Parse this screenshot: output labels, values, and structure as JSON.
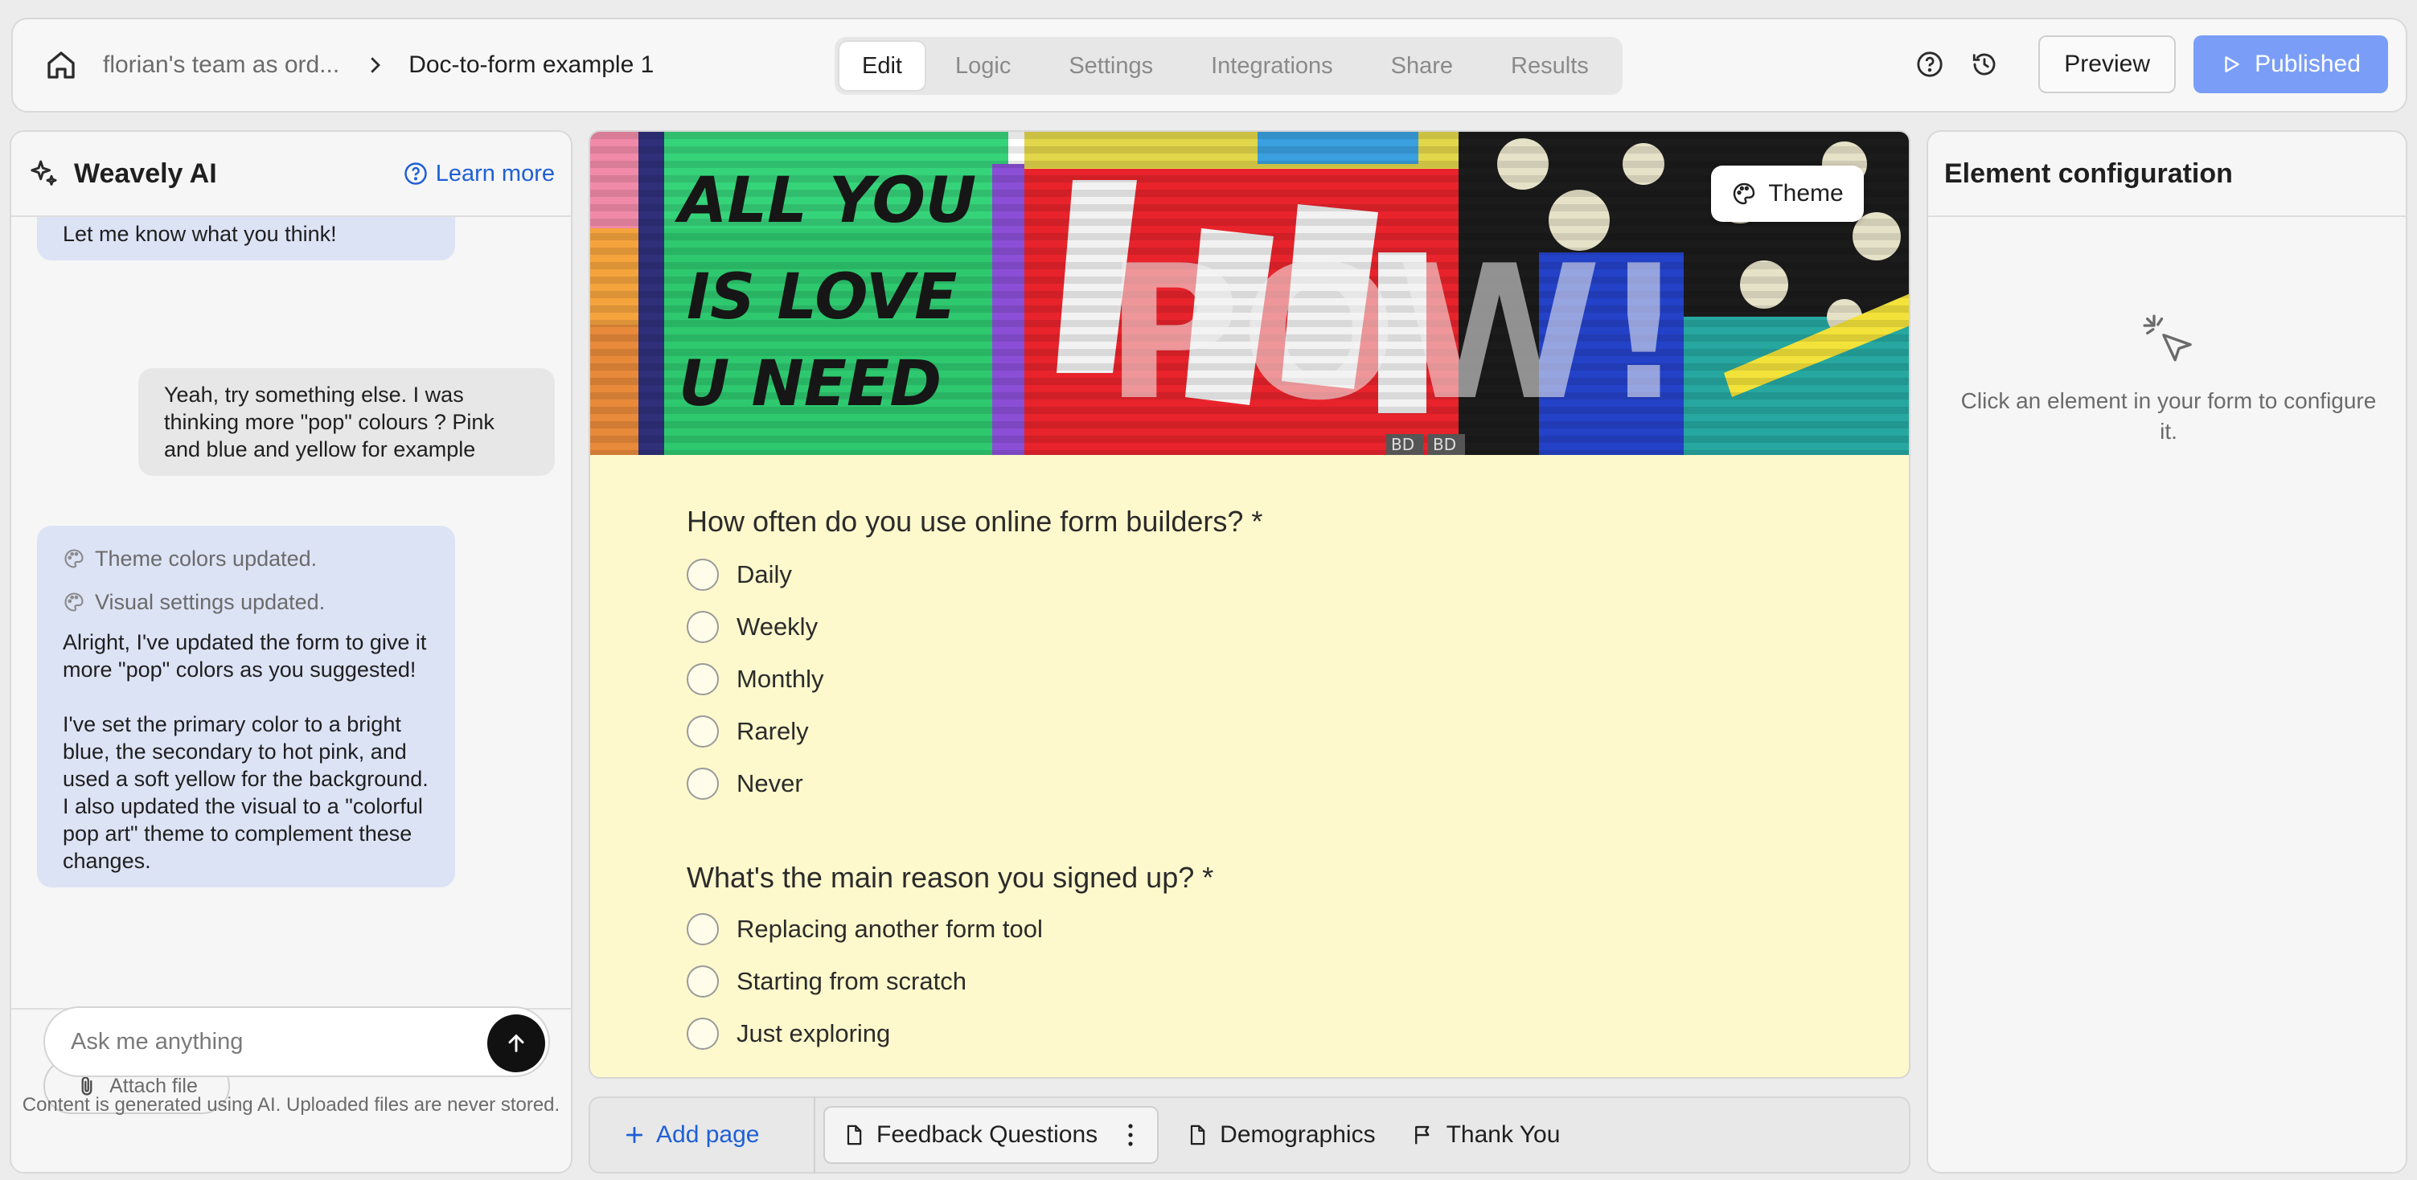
{
  "colors": {
    "accent": "#1f5fd6",
    "published_bg": "#7a9ef7",
    "form_background": "#fef9cc",
    "ai_bubble": "#dce3f5",
    "user_bubble": "#e7e7e7"
  },
  "header": {
    "breadcrumb": {
      "team": "florian's team as ord...",
      "form": "Doc-to-form example 1"
    },
    "tabs": [
      {
        "label": "Edit",
        "active": true
      },
      {
        "label": "Logic",
        "active": false
      },
      {
        "label": "Settings",
        "active": false
      },
      {
        "label": "Integrations",
        "active": false
      },
      {
        "label": "Share",
        "active": false
      },
      {
        "label": "Results",
        "active": false
      }
    ],
    "preview_label": "Preview",
    "published_label": "Published"
  },
  "ai_panel": {
    "title": "Weavely AI",
    "learn_more": "Learn more",
    "messages": {
      "m1": "Let me know what you think!",
      "m2": "Yeah, try something else. I was thinking more \"pop\" colours ? Pink and blue and yellow for example",
      "m3_status_1": "Theme colors updated.",
      "m3_status_2": "Visual settings updated.",
      "m3_p1": "Alright, I've updated the form to give it more \"pop\" colors as you suggested!",
      "m3_p2": "I've set the primary color to a bright blue, the secondary to hot pink, and used a soft yellow for the background. I also updated the visual to a \"colorful pop art\" theme to complement these changes."
    },
    "attach_label": "Attach file",
    "input_placeholder": "Ask me anything",
    "disclaimer": "Content is generated using AI. Uploaded files are never stored."
  },
  "form": {
    "theme_label": "Theme",
    "banner_art": [
      "ALL YOU",
      "IS LOVE",
      "U NEED",
      "POW!"
    ],
    "banner_tags": [
      "BD",
      "BD"
    ],
    "questions": [
      {
        "title": "How often do you use online form builders? *",
        "options": [
          "Daily",
          "Weekly",
          "Monthly",
          "Rarely",
          "Never"
        ]
      },
      {
        "title": "What's the main reason you signed up? *",
        "options": [
          "Replacing another form tool",
          "Starting from scratch",
          "Just exploring"
        ]
      }
    ]
  },
  "pages": {
    "add_label": "Add page",
    "items": [
      {
        "label": "Feedback Questions",
        "active": true
      },
      {
        "label": "Demographics",
        "active": false
      },
      {
        "label": "Thank You",
        "active": false
      }
    ]
  },
  "config_panel": {
    "title": "Element configuration",
    "hint": "Click an element in your form to configure it."
  }
}
